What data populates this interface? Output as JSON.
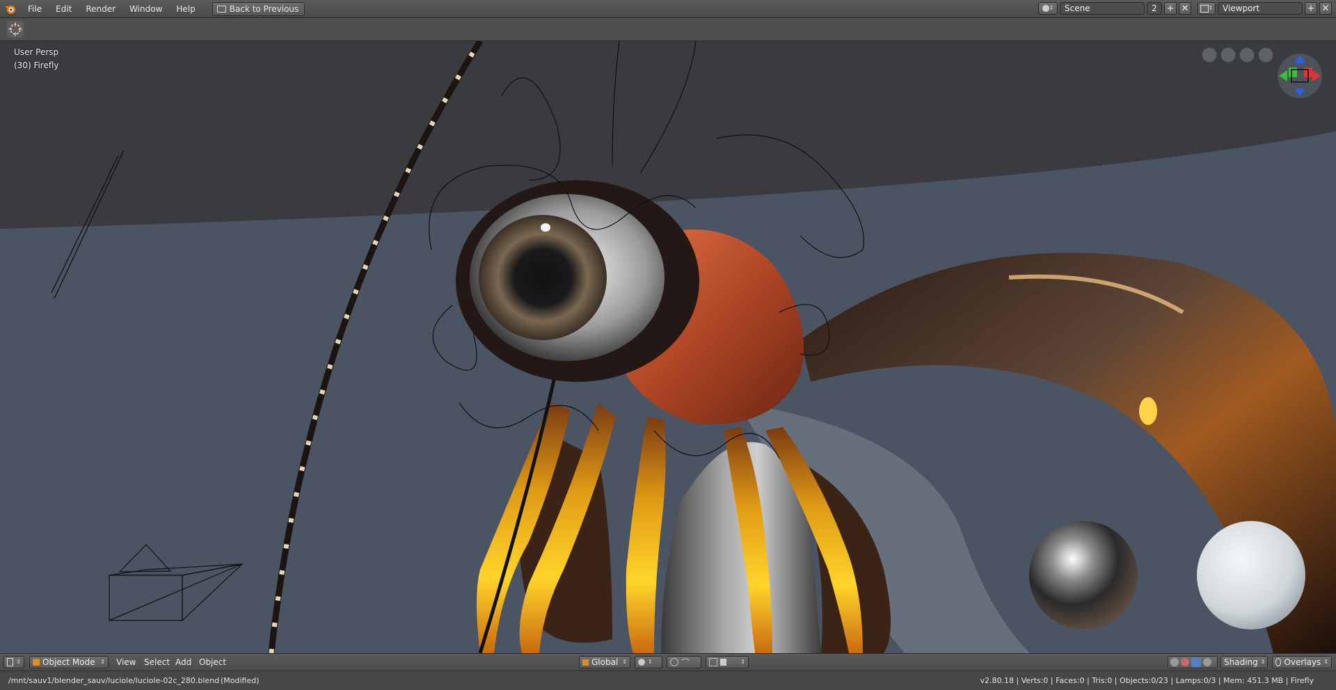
{
  "menubar": {
    "items": [
      "File",
      "Edit",
      "Render",
      "Window",
      "Help"
    ],
    "back_button": "Back to Previous",
    "scene_label": "Scene",
    "scene_users": "2",
    "workspace_label": "Viewport"
  },
  "viewport": {
    "view_name": "User Persp",
    "object_info": "(30) Firefly"
  },
  "footer": {
    "mode": "Object Mode",
    "menus": [
      "View",
      "Select",
      "Add",
      "Object"
    ],
    "orientation": "Global",
    "shading_label": "Shading",
    "overlays_label": "Overlays"
  },
  "status": {
    "filepath": "/mnt/sauv1/blender_sauv/luciole/luciole-02c_280.blend",
    "modified": "(Modified)",
    "stats": "v2.80.18 | Verts:0 | Faces:0 | Tris:0 | Objects:0/23 | Lamps:0/3 | Mem: 451.3 MB | Firefly"
  },
  "colors": {
    "accent_blue": "#5680c2",
    "axis_x": "#e03434",
    "axis_y": "#37c037",
    "axis_z": "#2f5fe0"
  }
}
